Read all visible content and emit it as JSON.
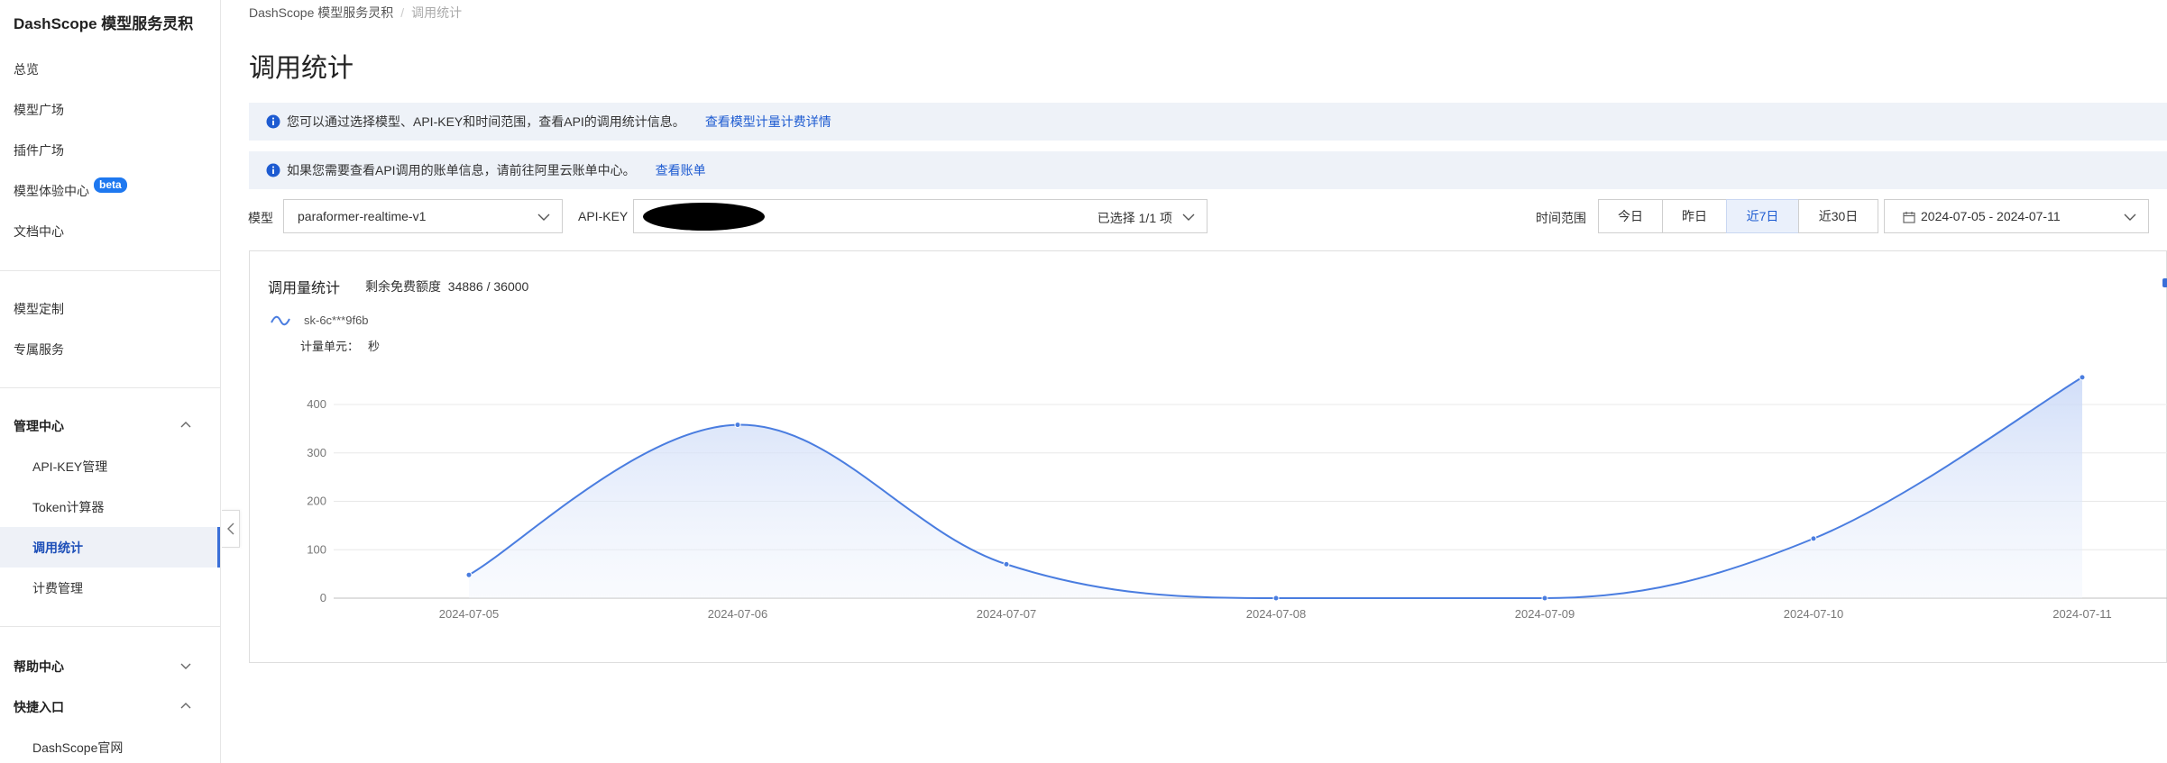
{
  "sidebar": {
    "brand": "DashScope 模型服务灵积",
    "items": [
      {
        "label": "总览"
      },
      {
        "label": "模型广场"
      },
      {
        "label": "插件广场"
      },
      {
        "label": "模型体验中心",
        "badge": "beta"
      },
      {
        "label": "文档中心"
      },
      {
        "label": "模型定制"
      },
      {
        "label": "专属服务"
      }
    ],
    "groups": {
      "manage": {
        "label": "管理中心",
        "items": [
          {
            "label": "API-KEY管理"
          },
          {
            "label": "Token计算器"
          },
          {
            "label": "调用统计"
          },
          {
            "label": "计费管理"
          }
        ]
      },
      "help": {
        "label": "帮助中心"
      },
      "quick": {
        "label": "快捷入口",
        "items": [
          {
            "label": "DashScope官网"
          }
        ]
      }
    }
  },
  "breadcrumb": {
    "root": "DashScope 模型服务灵积",
    "current": "调用统计"
  },
  "page_title": "调用统计",
  "notices": [
    {
      "text": "您可以通过选择模型、API-KEY和时间范围，查看API的调用统计信息。",
      "link": "查看模型计量计费详情"
    },
    {
      "text": "如果您需要查看API调用的账单信息，请前往阿里云账单中心。",
      "link": "查看账单"
    }
  ],
  "filters": {
    "model_label": "模型",
    "model_value": "paraformer-realtime-v1",
    "apikey_label": "API-KEY",
    "apikey_selected": "已选择 1/1 项",
    "time_label": "时间范围",
    "time_options": [
      "今日",
      "昨日",
      "近7日",
      "近30日"
    ],
    "time_selected": "近7日",
    "date_range": "2024-07-05 - 2024-07-11"
  },
  "card": {
    "title": "调用量统计",
    "quota_label": "剩余免费额度",
    "quota_value": "34886 / 36000",
    "unit_label": "计量单元：",
    "unit_value": "秒"
  },
  "chart_data": {
    "type": "area",
    "x": [
      "2024-07-05",
      "2024-07-06",
      "2024-07-07",
      "2024-07-08",
      "2024-07-09",
      "2024-07-10",
      "2024-07-11"
    ],
    "series": [
      {
        "name": "sk-6c***9f6b",
        "values": [
          48,
          358,
          70,
          0,
          0,
          123,
          456
        ]
      }
    ],
    "yticks": [
      0,
      100,
      200,
      300,
      400
    ],
    "ylim": [
      0,
      400
    ],
    "grid": true,
    "color": "#4a7de0"
  },
  "colors": {
    "accent": "#1d5bd1",
    "active_bg": "#eef1f7",
    "notice_bg": "#eef2f8"
  }
}
